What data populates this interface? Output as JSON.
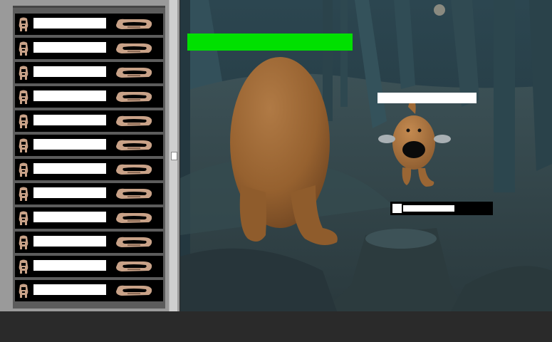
{
  "sidebar": {
    "slots": [
      {
        "label": "",
        "icon": "character-icon",
        "action_icon": "hand-icon"
      },
      {
        "label": "",
        "icon": "character-icon",
        "action_icon": "hand-icon"
      },
      {
        "label": "",
        "icon": "character-icon",
        "action_icon": "hand-icon"
      },
      {
        "label": "",
        "icon": "character-icon",
        "action_icon": "hand-icon"
      },
      {
        "label": "",
        "icon": "character-icon",
        "action_icon": "hand-icon"
      },
      {
        "label": "",
        "icon": "character-icon",
        "action_icon": "hand-icon"
      },
      {
        "label": "",
        "icon": "character-icon",
        "action_icon": "hand-icon"
      },
      {
        "label": "",
        "icon": "character-icon",
        "action_icon": "hand-icon"
      },
      {
        "label": "",
        "icon": "character-icon",
        "action_icon": "hand-icon"
      },
      {
        "label": "",
        "icon": "character-icon",
        "action_icon": "hand-icon"
      },
      {
        "label": "",
        "icon": "character-icon",
        "action_icon": "hand-icon"
      },
      {
        "label": "",
        "icon": "character-icon",
        "action_icon": "hand-icon"
      }
    ]
  },
  "player": {
    "health_fraction": 1.0,
    "health_color": "#00e000"
  },
  "enemy": {
    "name": "",
    "health_fraction": 0.58,
    "health_color": "#ffffff"
  },
  "scene": {
    "setting": "night-forest",
    "player_character": "potato-creature",
    "enemy_character": "screaming-creature"
  }
}
